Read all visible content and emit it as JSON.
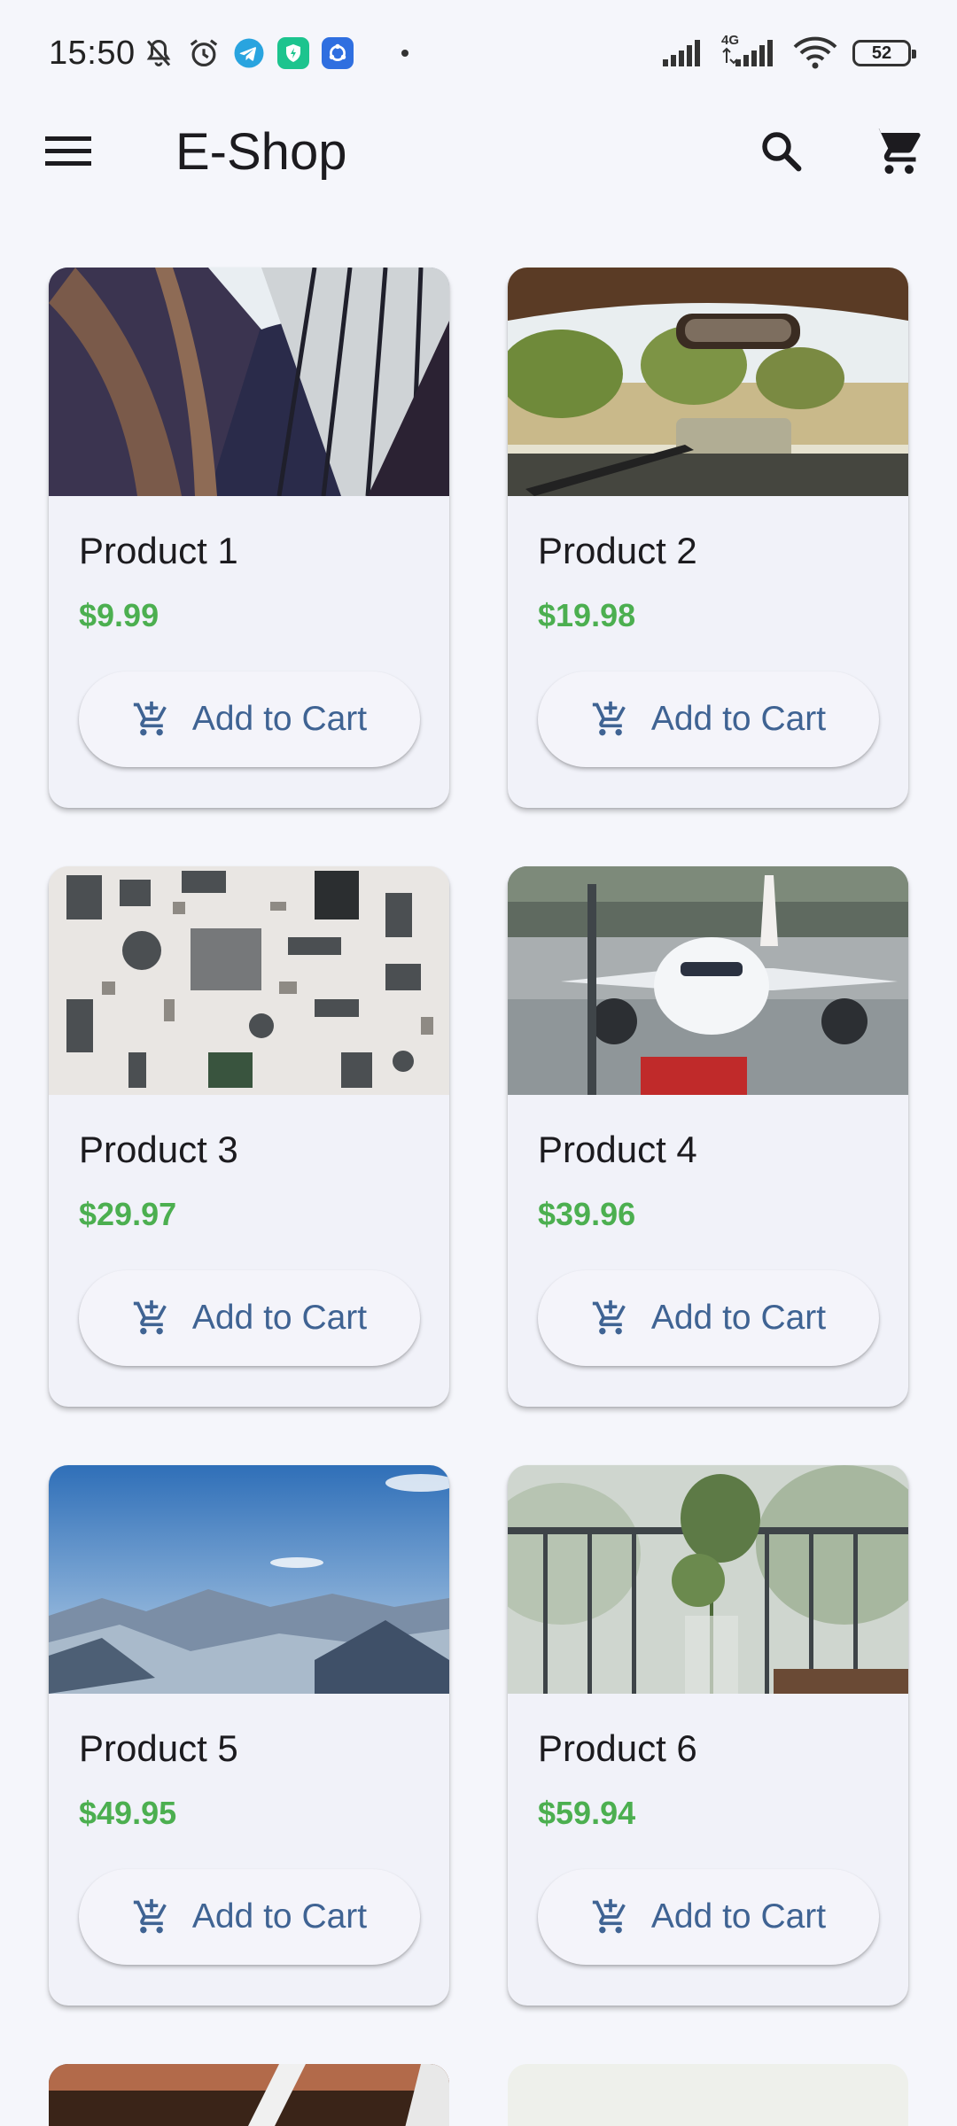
{
  "status_bar": {
    "time": "15:50",
    "network_label": "4G",
    "battery": "52",
    "icons": [
      "mute-bell-icon",
      "alarm-icon",
      "telegram-icon",
      "shield-app-icon",
      "sync-app-icon",
      "signal-icon",
      "signal-4g-icon",
      "wifi-icon",
      "battery-icon"
    ]
  },
  "app_bar": {
    "title": "E-Shop",
    "icons": [
      "menu-icon",
      "search-icon",
      "cart-icon"
    ]
  },
  "products": [
    {
      "name": "Product 1",
      "price": "$9.99",
      "button": "Add to Cart",
      "image": "library-photo"
    },
    {
      "name": "Product 2",
      "price": "$19.98",
      "button": "Add to Cart",
      "image": "car-windshield-photo"
    },
    {
      "name": "Product 3",
      "price": "$29.97",
      "button": "Add to Cart",
      "image": "electronic-parts-photo"
    },
    {
      "name": "Product 4",
      "price": "$39.96",
      "button": "Add to Cart",
      "image": "airplane-photo"
    },
    {
      "name": "Product 5",
      "price": "$49.95",
      "button": "Add to Cart",
      "image": "mountains-photo"
    },
    {
      "name": "Product 6",
      "price": "$59.94",
      "button": "Add to Cart",
      "image": "plant-balcony-photo"
    }
  ],
  "colors": {
    "background": "#f5f6fb",
    "card": "#f1f2f9",
    "price": "#4caf50",
    "button_text": "#3f6393"
  }
}
